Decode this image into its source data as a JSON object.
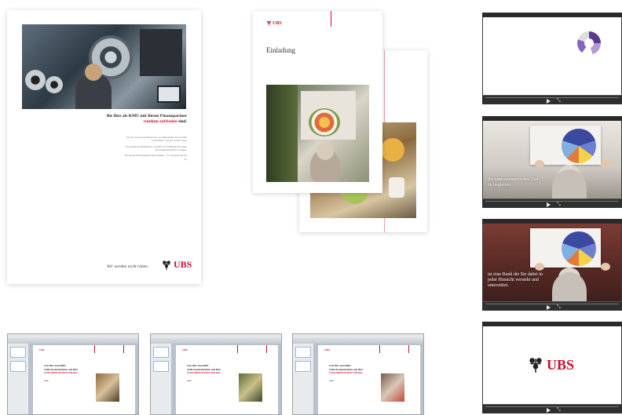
{
  "poster": {
    "headline_line1": "Bis Ihre als KMU mit Ihrem Finanzpartner",
    "headline_line2": "rundum zufrieden",
    "headline_line3": "sind.",
    "body_p1": "Tun Sie, was Sie am liebsten tun, als Unternehmer: Ihr Geschäft voranbringen – mit uns an Ihrer Seite.",
    "body_p2": "Wir kennen die Bedürfnisse von KMU aus Erfahrung und sorgen für massgeschneiderte Lösungen.",
    "body_p3": "Für uns hat Ihr Engagement einen Namen – wir sind gerne für Sie da.",
    "slogan": "Wir werden nicht ruhen",
    "logo_text": "UBS"
  },
  "invitation": {
    "logo_text": "UBS",
    "title": "Einladung"
  },
  "videos": [
    {
      "caption": ""
    },
    {
      "caption": "Ihr unternehmerisches Ziel zu begleiten"
    },
    {
      "caption": "ist eine Bank die Sie dabei in jeder Hinsicht versteht und unterstützt."
    },
    {
      "logo_text": "UBS"
    }
  ],
  "screenshots": [
    {
      "logo": "UBS",
      "line1": "Gut fürs Geschäft:",
      "line2": "Volle Konzentration auf Ihre",
      "line3": "Unternehmerischen Stärken.",
      "sub": "Name"
    },
    {
      "logo": "UBS",
      "line1": "Gut fürs Geschäft:",
      "line2": "Volle Konzentration auf Ihre",
      "line3": "Unternehmerischen Stärken.",
      "sub": "Name"
    },
    {
      "logo": "UBS",
      "line1": "Gut fürs Geschäft:",
      "line2": "Volle Konzentration auf Ihre",
      "line3": "Unternehmerischen Stärken.",
      "sub": "Name"
    }
  ],
  "colors": {
    "brand_red": "#c8102e"
  },
  "icons": [
    "ubs-keys-icon",
    "play-icon",
    "expand-icon"
  ]
}
